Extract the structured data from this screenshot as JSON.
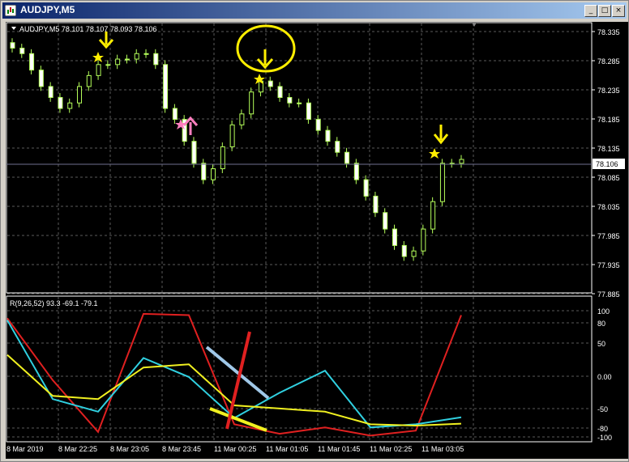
{
  "window": {
    "title": "AUDJPY,M5",
    "buttons": {
      "minimize": "_",
      "maximize": "□",
      "close": "×"
    }
  },
  "chart": {
    "header": "AUDJPY,M5  78.101 78.107 78.093 78.106",
    "current_price_label": "78.106",
    "price_ticks": [
      "78.335",
      "78.285",
      "78.235",
      "78.185",
      "78.135",
      "78.085",
      "78.035",
      "77.985",
      "77.935",
      "77.885"
    ],
    "time_labels": [
      "8 Mar 2019",
      "8 Mar 22:25",
      "8 Mar 23:05",
      "8 Mar 23:45",
      "11 Mar 00:25",
      "11 Mar 01:05",
      "11 Mar 01:45",
      "11 Mar 02:25",
      "11 Mar 03:05"
    ],
    "colors": {
      "background": "#000000",
      "bull_candle": "#b5ff5a",
      "grid": "#7a7a7a",
      "arrow_down": "#ffee00",
      "arrow_up": "#ff7fbf",
      "star": "#ffee00",
      "circle": "#ffee00",
      "price_line": "#707090"
    }
  },
  "indicator": {
    "header": "R(9,26,52) 93.3 -69.1 -79.1",
    "ticks": [
      "100",
      "80",
      "50",
      "0.00",
      "-50",
      "-80",
      "-100"
    ],
    "colors": {
      "red": "#e02020",
      "cyan": "#30d0e0",
      "yellow": "#f0f020",
      "light_blue": "#a0c8e8"
    }
  },
  "chart_data": {
    "type": "line",
    "title": "AUDJPY,M5",
    "x": [
      "8 Mar 2019",
      "8 Mar 22:25",
      "8 Mar 23:05",
      "8 Mar 23:45",
      "11 Mar 00:25",
      "11 Mar 01:05",
      "11 Mar 01:45",
      "11 Mar 02:25",
      "11 Mar 03:05"
    ],
    "price_ylim": [
      77.865,
      78.355
    ],
    "candles_close_estimate": [
      78.3,
      78.27,
      78.22,
      78.21,
      78.25,
      78.28,
      78.29,
      78.3,
      78.19,
      78.14,
      78.1,
      78.07,
      78.15,
      78.22,
      78.24,
      78.22,
      78.16,
      78.1,
      78.04,
      77.97,
      77.93,
      78.09,
      78.106
    ],
    "series": [
      {
        "name": "R(9)",
        "values": [
          88,
          -10,
          -92,
          95,
          93,
          -80,
          -95,
          -85,
          -98,
          -90,
          93
        ]
      },
      {
        "name": "R(26)",
        "values": [
          85,
          -40,
          -60,
          25,
          -5,
          -70,
          -30,
          5,
          -85,
          -80,
          -69
        ]
      },
      {
        "name": "R(52)",
        "values": [
          30,
          -35,
          -40,
          10,
          15,
          -50,
          -55,
          -60,
          -80,
          -82,
          -79
        ]
      }
    ],
    "indicator_ylim": [
      -100,
      100
    ]
  }
}
